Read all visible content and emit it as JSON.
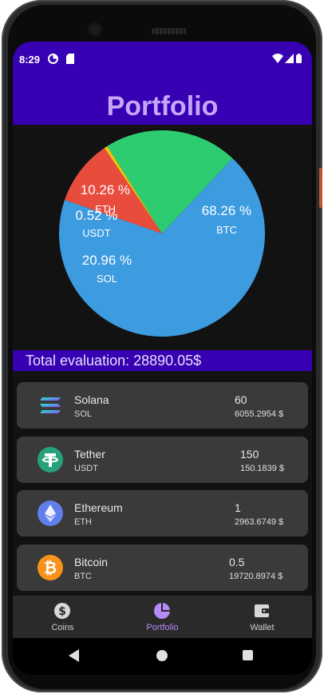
{
  "status_bar": {
    "time": "8:29",
    "notification_icons": [
      "data-saver-icon",
      "sd-card-icon"
    ],
    "system_icons": [
      "wifi-icon",
      "signal-icon",
      "battery-icon"
    ]
  },
  "header": {
    "title": "Portfolio"
  },
  "chart_data": {
    "type": "pie",
    "slices": [
      {
        "label": "BTC",
        "percent_label": "68.26 %",
        "value": 68.26,
        "color": "#3d9be0"
      },
      {
        "label": "SOL",
        "percent_label": "20.96 %",
        "value": 20.96,
        "color": "#2ecc71"
      },
      {
        "label": "USDT",
        "percent_label": "0.52 %",
        "value": 0.52,
        "color": "#f1c40f"
      },
      {
        "label": "ETH",
        "percent_label": "10.26 %",
        "value": 10.26,
        "color": "#e74c3c"
      }
    ]
  },
  "total": {
    "text": "Total evaluation: 28890.05$"
  },
  "coins": [
    {
      "name": "Solana",
      "symbol": "SOL",
      "amount": "60",
      "value": "6055.2954 $",
      "icon": "solana-icon"
    },
    {
      "name": "Tether",
      "symbol": "USDT",
      "amount": "150",
      "value": "150.1839 $",
      "icon": "tether-icon"
    },
    {
      "name": "Ethereum",
      "symbol": "ETH",
      "amount": "1",
      "value": "2963.6749 $",
      "icon": "ethereum-icon"
    },
    {
      "name": "Bitcoin",
      "symbol": "BTC",
      "amount": "0.5",
      "value": "19720.8974 $",
      "icon": "bitcoin-icon"
    }
  ],
  "bottom_nav": [
    {
      "label": "Coins",
      "icon": "dollar-coin-icon",
      "active": false
    },
    {
      "label": "Portfolio",
      "icon": "pie-chart-icon",
      "active": true
    },
    {
      "label": "Wallet",
      "icon": "wallet-icon",
      "active": false
    }
  ],
  "colors": {
    "primary": "#3700b3",
    "title_text": "#c5a6f9",
    "active_nav": "#b68af7",
    "background": "#121212",
    "card": "#3a3a3a"
  }
}
